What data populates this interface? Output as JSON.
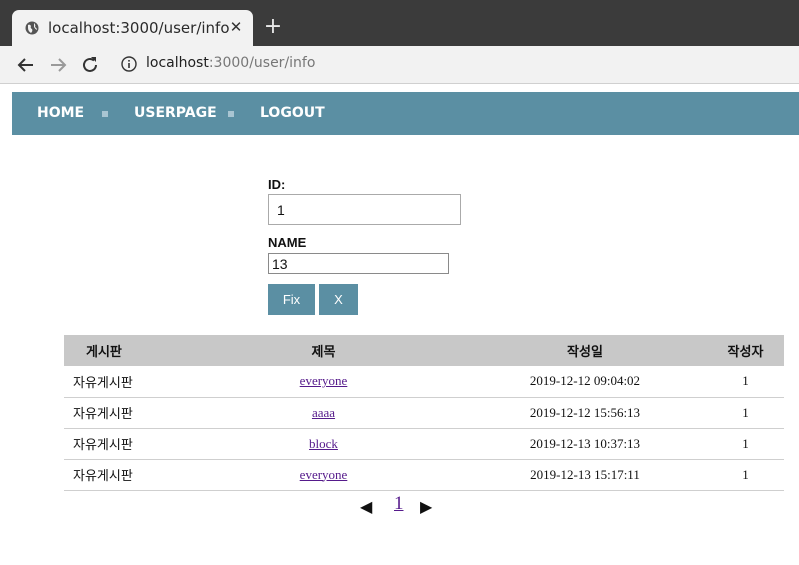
{
  "browser": {
    "tab_title": "localhost:3000/user/info",
    "tab_close": "✕",
    "new_tab": "+",
    "url_host": "localhost",
    "url_rest": ":3000/user/info"
  },
  "nav": {
    "home": "HOME",
    "userpage": "USERPAGE",
    "logout": "LOGOUT"
  },
  "form": {
    "id_label": "ID:",
    "id_value": "1",
    "name_label": "NAME",
    "name_value": "13",
    "fix_label": "Fix",
    "cancel_label": "X"
  },
  "table": {
    "headers": [
      "게시판",
      "제목",
      "작성일",
      "작성자"
    ],
    "rows": [
      {
        "board": "자유게시판",
        "title": "everyone",
        "date": "2019-12-12 09:04:02",
        "author": "1"
      },
      {
        "board": "자유게시판",
        "title": "aaaa",
        "date": "2019-12-12 15:56:13",
        "author": "1"
      },
      {
        "board": "자유게시판",
        "title": "block",
        "date": "2019-12-13 10:37:13",
        "author": "1"
      },
      {
        "board": "자유게시판",
        "title": "everyone",
        "date": "2019-12-13 15:17:11",
        "author": "1"
      }
    ]
  },
  "pagination": {
    "prev": "◀",
    "current": "1",
    "next": "▶"
  },
  "colors": {
    "navbar": "#5b8fa3",
    "table_header": "#c8c8c8",
    "link": "#551a8b"
  }
}
